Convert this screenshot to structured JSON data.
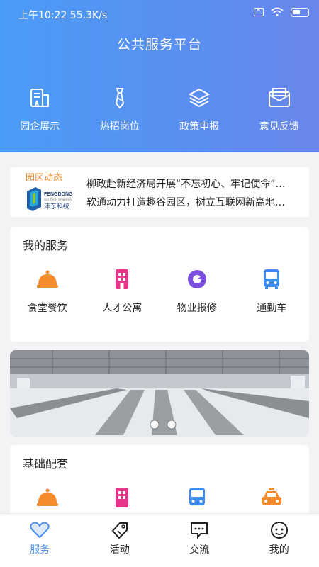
{
  "status_bar": {
    "time_speed": "上午10:22 55.3K/s"
  },
  "header": {
    "title": "公共服务平台",
    "menu": [
      {
        "label": "园企展示",
        "icon": "building-icon"
      },
      {
        "label": "热招岗位",
        "icon": "tie-icon"
      },
      {
        "label": "政策申报",
        "icon": "layers-icon"
      },
      {
        "label": "意见反馈",
        "icon": "mail-icon"
      }
    ]
  },
  "news": {
    "label": "园区动态",
    "logo_text": "FENGDONG",
    "logo_sub": "SCI-TECH SYNERGY",
    "logo_cn": "沣东科统",
    "lines": [
      "柳政赴新经济局开展“不忘初心、牢记使命”…",
      "软通动力打造趣谷园区，树立互联网新高地…"
    ]
  },
  "my_services": {
    "title": "我的服务",
    "items": [
      {
        "label": "食堂餐饮",
        "icon": "food-cloche-icon"
      },
      {
        "label": "人才公寓",
        "icon": "apartment-icon"
      },
      {
        "label": "物业报修",
        "icon": "repair-icon"
      },
      {
        "label": "通勤车",
        "icon": "bus-icon"
      }
    ]
  },
  "basic": {
    "title": "基础配套",
    "items": [
      {
        "icon": "food-cloche-icon"
      },
      {
        "icon": "apartment-icon"
      },
      {
        "icon": "bus-icon"
      },
      {
        "icon": "taxi-icon"
      }
    ]
  },
  "tabbar": {
    "tabs": [
      {
        "label": "服务",
        "icon": "heart-icon",
        "active": true
      },
      {
        "label": "活动",
        "icon": "tag-icon"
      },
      {
        "label": "交流",
        "icon": "chat-icon"
      },
      {
        "label": "我的",
        "icon": "smile-icon"
      }
    ]
  },
  "colors": {
    "accent": "#4a90f2",
    "orange": "#f38a2c",
    "pink": "#e8358a",
    "purple": "#7b4fe0",
    "blue": "#3d8af0"
  }
}
